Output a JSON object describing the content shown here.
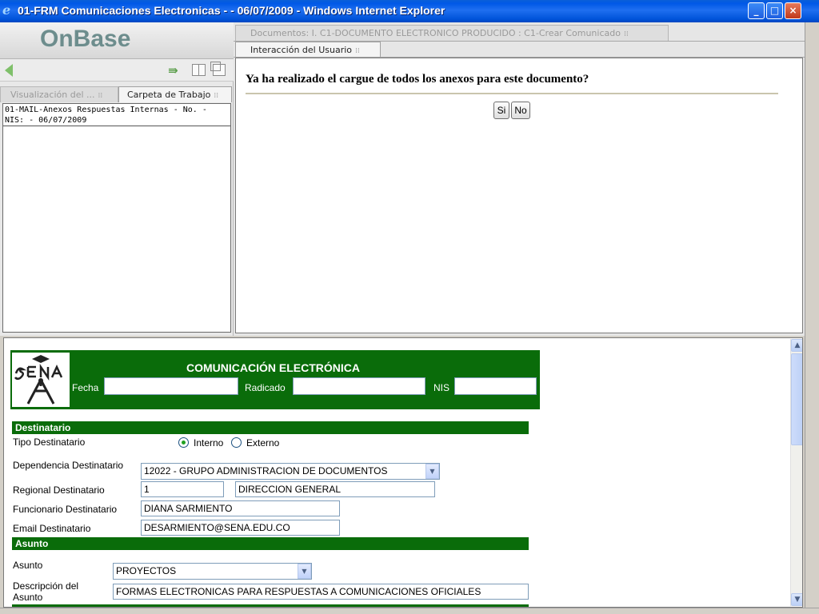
{
  "window": {
    "title": "01-FRM Comunicaciones Electronicas - - 06/07/2009 - Windows Internet Explorer",
    "minimize": "_",
    "maximize": "□",
    "close": "×"
  },
  "left_pane": {
    "logo": "OnBase",
    "tabs": [
      "Visualización del ...",
      "Carpeta de Trabajo"
    ],
    "documents": [
      "01-MAIL-Anexos Respuestas Internas - No. - NIS: - 06/07/2009"
    ]
  },
  "right_pane": {
    "tab_documents": "Documentos: I. C1-DOCUMENTO ELECTRONICO PRODUCIDO : C1-Crear Comunicado",
    "tab_interaction": "Interacción del Usuario",
    "question": "Ya ha realizado el cargue de todos los anexos para este documento?",
    "yes_label": "Si",
    "no_label": "No"
  },
  "form": {
    "logo_text": "SENA",
    "title": "COMUNICACIÓN ELECTRÓNICA",
    "fecha_label": "Fecha",
    "fecha_value": "",
    "radicado_label": "Radicado",
    "radicado_value": "",
    "nis_label": "NIS",
    "nis_value": "",
    "destinatario_section": "Destinatario",
    "tipo_label": "Tipo Destinatario",
    "tipo_options": [
      "Interno",
      "Externo"
    ],
    "tipo_selected": "Interno",
    "dependencia_label": "Dependencia Destinatario",
    "dependencia_value": "12022 - GRUPO ADMINISTRACION DE DOCUMENTOS",
    "regional_label": "Regional Destinatario",
    "regional_code": "1",
    "regional_name": "DIRECCION GENERAL",
    "funcionario_label": "Funcionario Destinatario",
    "funcionario_value": "DIANA SARMIENTO",
    "email_label": "Email Destinatario",
    "email_value": "DESARMIENTO@SENA.EDU.CO",
    "asunto_section": "Asunto",
    "asunto_label": "Asunto",
    "asunto_value": "PROYECTOS",
    "descripcion_label_1": "Descripción del",
    "descripcion_label_2": "Asunto",
    "descripcion_value": "FORMAS ELECTRONICAS PARA RESPUESTAS A COMUNICACIONES OFICIALES"
  },
  "icons": {
    "back": "back-arrow-icon",
    "forward": "forward-arrows-icon",
    "split": "split-view-icon",
    "window": "new-window-icon",
    "scroll_up": "▲",
    "scroll_down": "▼",
    "dropdown": "▼"
  },
  "colors": {
    "titlebar": "#0058e6",
    "form_green": "#0a6c0a",
    "radio_checked": "#21a121"
  }
}
